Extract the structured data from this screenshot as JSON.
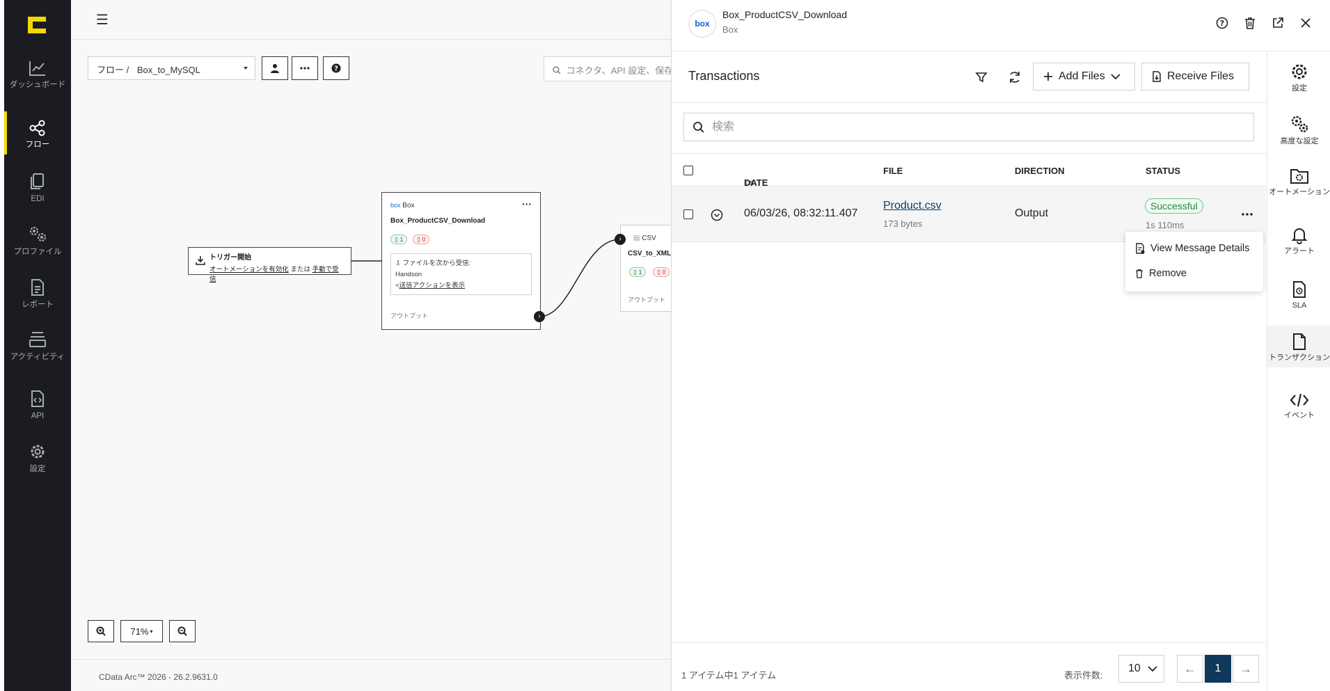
{
  "nav": {
    "items": [
      {
        "label": "ダッシュボード",
        "icon": "chart-line-icon"
      },
      {
        "label": "フロー",
        "icon": "share-nodes-icon"
      },
      {
        "label": "EDI",
        "icon": "documents-icon"
      },
      {
        "label": "プロファイル",
        "icon": "gears-icon"
      },
      {
        "label": "レポート",
        "icon": "report-icon"
      },
      {
        "label": "アクティビティ",
        "icon": "layers-icon"
      },
      {
        "label": "API",
        "icon": "api-doc-icon"
      },
      {
        "label": "設定",
        "icon": "gear-icon"
      }
    ],
    "active": "フロー",
    "accent": "#f5d800"
  },
  "canvas": {
    "breadcrumb_root": "フロー /",
    "breadcrumb_flow": "Box_to_MySQL",
    "search_placeholder": "コネクタ、API 設定、保存",
    "trigger": {
      "title": "トリガー開始",
      "link1": "オートメーションを有効化",
      "or": "または",
      "link2": "手動で受信"
    },
    "node1": {
      "connector": "Box",
      "logo": "box",
      "name": "Box_ProductCSV_Download",
      "success_count": "1",
      "error_count": "0",
      "receive_label": "ファイルを次から受信:",
      "receive_source": "Handson",
      "send_action_link": "送信アクションを表示",
      "output_label": "アウトプット"
    },
    "node2": {
      "connector": "CSV",
      "name": "CSV_to_XML",
      "success_count": "1",
      "error_count": "0",
      "output_label": "アウトプット"
    },
    "zoom_level": "71%",
    "footer": "CData Arc™ 2026 - 26.2.9631.0"
  },
  "panel": {
    "logo": "box",
    "title": "Box_ProductCSV_Download",
    "subtitle": "Box",
    "section_title": "Transactions",
    "add_files_label": "Add Files",
    "receive_files_label": "Receive Files",
    "search_placeholder": "検索",
    "columns": {
      "date": "DATE",
      "file": "FILE",
      "direction": "DIRECTION",
      "status": "STATUS"
    },
    "rows": [
      {
        "date": "06/03/26, 08:32:11.407",
        "file": "Product.csv",
        "size": "173 bytes",
        "direction": "Output",
        "status": "Successful",
        "duration": "1s 110ms"
      }
    ],
    "row_menu": {
      "view_details": "View Message Details",
      "remove": "Remove"
    },
    "footer": {
      "count_text": "1 アイテム中1 アイテム",
      "per_page_label": "表示件数:",
      "per_page_value": "10",
      "current_page": "1"
    },
    "status_color": "#1e8a3e",
    "pager_active_color": "#10385b"
  },
  "rail": {
    "items": [
      {
        "label": "設定",
        "icon": "gear-icon"
      },
      {
        "label": "高度な設定",
        "icon": "gears-icon"
      },
      {
        "label": "オートメーション",
        "icon": "folder-gear-icon"
      },
      {
        "label": "アラート",
        "icon": "bell-icon"
      },
      {
        "label": "SLA",
        "icon": "sla-doc-icon"
      },
      {
        "label": "トランザクション",
        "icon": "file-icon"
      },
      {
        "label": "イベント",
        "icon": "code-icon"
      }
    ],
    "active": "トランザクション"
  }
}
